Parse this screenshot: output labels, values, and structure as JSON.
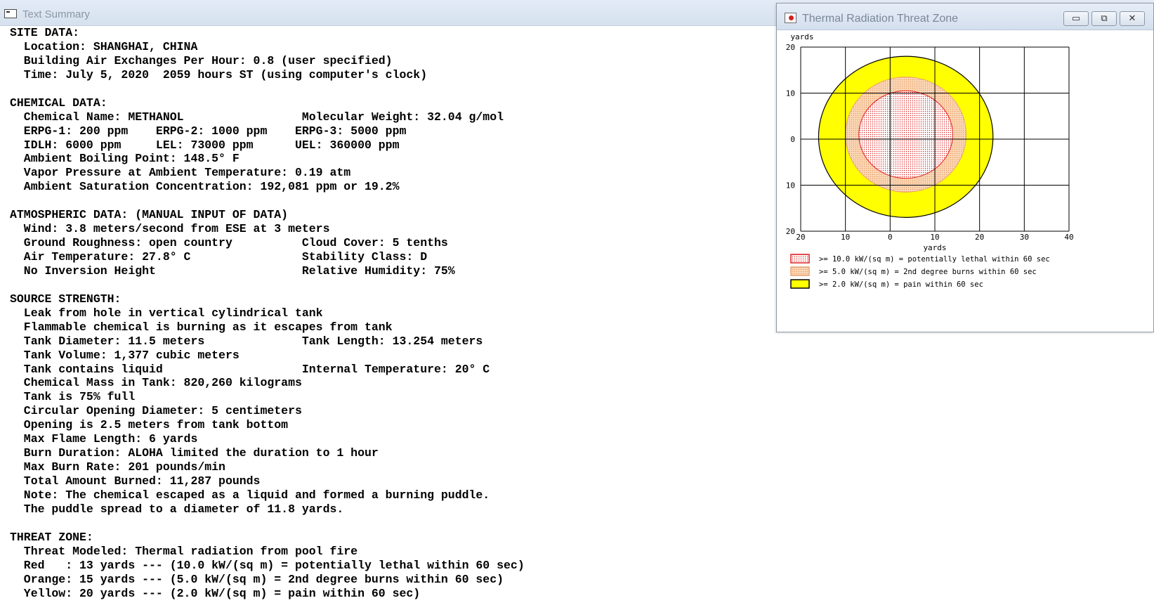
{
  "text_summary": {
    "title": "Text Summary",
    "lines": [
      "SITE DATA:",
      "  Location: SHANGHAI, CHINA",
      "  Building Air Exchanges Per Hour: 0.8 (user specified)",
      "  Time: July 5, 2020  2059 hours ST (using computer's clock)",
      "",
      "CHEMICAL DATA:",
      "  Chemical Name: METHANOL                 Molecular Weight: 32.04 g/mol",
      "  ERPG-1: 200 ppm    ERPG-2: 1000 ppm    ERPG-3: 5000 ppm",
      "  IDLH: 6000 ppm     LEL: 73000 ppm      UEL: 360000 ppm",
      "  Ambient Boiling Point: 148.5° F",
      "  Vapor Pressure at Ambient Temperature: 0.19 atm",
      "  Ambient Saturation Concentration: 192,081 ppm or 19.2%",
      "",
      "ATMOSPHERIC DATA: (MANUAL INPUT OF DATA)",
      "  Wind: 3.8 meters/second from ESE at 3 meters",
      "  Ground Roughness: open country          Cloud Cover: 5 tenths",
      "  Air Temperature: 27.8° C                Stability Class: D",
      "  No Inversion Height                     Relative Humidity: 75%",
      "",
      "SOURCE STRENGTH:",
      "  Leak from hole in vertical cylindrical tank",
      "  Flammable chemical is burning as it escapes from tank",
      "  Tank Diameter: 11.5 meters              Tank Length: 13.254 meters",
      "  Tank Volume: 1,377 cubic meters",
      "  Tank contains liquid                    Internal Temperature: 20° C",
      "  Chemical Mass in Tank: 820,260 kilograms",
      "  Tank is 75% full",
      "  Circular Opening Diameter: 5 centimeters",
      "  Opening is 2.5 meters from tank bottom",
      "  Max Flame Length: 6 yards",
      "  Burn Duration: ALOHA limited the duration to 1 hour",
      "  Max Burn Rate: 201 pounds/min",
      "  Total Amount Burned: 11,287 pounds",
      "  Note: The chemical escaped as a liquid and formed a burning puddle.",
      "  The puddle spread to a diameter of 11.8 yards.",
      "",
      "THREAT ZONE:",
      "  Threat Modeled: Thermal radiation from pool fire",
      "  Red   : 13 yards --- (10.0 kW/(sq m) = potentially lethal within 60 sec)",
      "  Orange: 15 yards --- (5.0 kW/(sq m) = 2nd degree burns within 60 sec)",
      "  Yellow: 20 yards --- (2.0 kW/(sq m) = pain within 60 sec)"
    ]
  },
  "threat_window": {
    "title": "Thermal Radiation Threat Zone",
    "buttons": {
      "minimize": "▭",
      "maximize": "⧉",
      "close": "✕"
    },
    "colors": {
      "red": "#e02020",
      "orange": "#f8c8a0",
      "yellow": "#ffff00"
    }
  },
  "chart_data": {
    "type": "area",
    "xlabel": "yards",
    "ylabel": "yards",
    "xlim": [
      -20,
      40
    ],
    "ylim": [
      -20,
      20
    ],
    "x_ticks": [
      "20",
      "10",
      "0",
      "10",
      "20",
      "30",
      "40"
    ],
    "y_ticks": [
      "20",
      "10",
      "0",
      "10",
      "20"
    ],
    "x_tick_values": [
      -20,
      -10,
      0,
      10,
      20,
      30,
      40
    ],
    "y_tick_values": [
      20,
      10,
      0,
      -10,
      -20
    ],
    "grid": true,
    "zones": [
      {
        "name": "yellow",
        "legend": ">= 2.0 kW/(sq m) = pain within 60 sec",
        "rx": 19.5,
        "ry": 17.5,
        "cx": 3.5,
        "cy": 0.5,
        "fill": "#ffff00",
        "stroke": "#000000"
      },
      {
        "name": "orange",
        "legend": ">= 5.0 kW/(sq m) = 2nd degree burns within 60 sec",
        "rx": 13.5,
        "ry": 12.5,
        "cx": 3.5,
        "cy": 1,
        "fill": "#f8c8a0",
        "stroke": "#e8a070"
      },
      {
        "name": "red",
        "legend": ">= 10.0 kW/(sq m) = potentially lethal within 60 sec",
        "rx": 10.5,
        "ry": 9.5,
        "cx": 3.5,
        "cy": 1,
        "fill": "#fde0dc",
        "stroke": "#e02020"
      }
    ],
    "legend": [
      {
        "label": ">= 10.0 kW/(sq m) = potentially lethal within 60 sec",
        "fill": "#fde0dc",
        "stroke": "#e02020"
      },
      {
        "label": ">= 5.0 kW/(sq m) = 2nd degree burns within 60 sec",
        "fill": "#f8c8a0",
        "stroke": "#e8a070"
      },
      {
        "label": ">= 2.0 kW/(sq m) = pain within 60 sec",
        "fill": "#ffff00",
        "stroke": "#000000"
      }
    ]
  }
}
